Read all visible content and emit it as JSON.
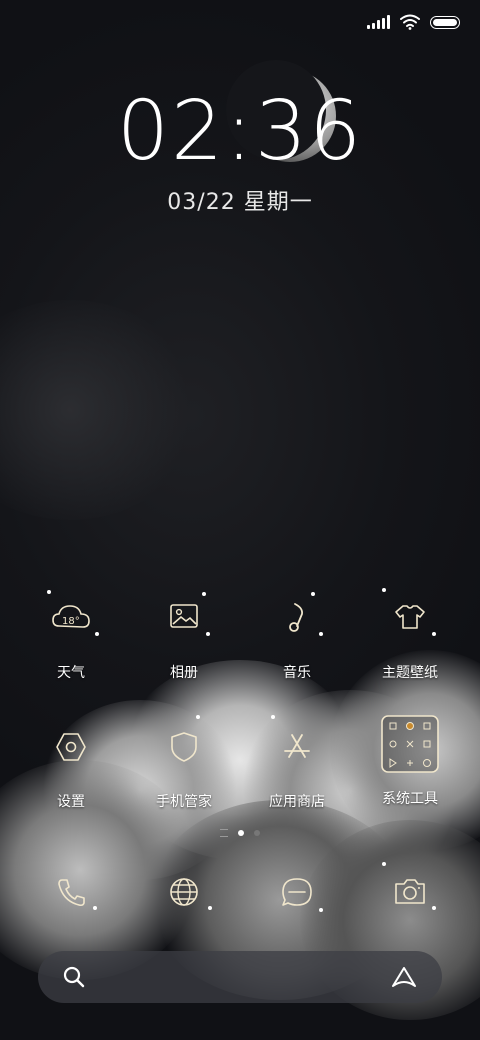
{
  "status_bar": {
    "icons": [
      "signal-icon",
      "wifi-icon",
      "battery-icon"
    ]
  },
  "lock": {
    "time": "02:36",
    "date": "03/22 星期一"
  },
  "apps": [
    {
      "label": "天气",
      "icon": "weather-icon",
      "temp": "18°"
    },
    {
      "label": "相册",
      "icon": "gallery-icon"
    },
    {
      "label": "音乐",
      "icon": "music-icon"
    },
    {
      "label": "主题壁纸",
      "icon": "theme-icon"
    },
    {
      "label": "设置",
      "icon": "settings-icon"
    },
    {
      "label": "手机管家",
      "icon": "security-icon"
    },
    {
      "label": "应用商店",
      "icon": "app-store-icon"
    },
    {
      "label": "系统工具",
      "icon": "folder-icon"
    }
  ],
  "dock": [
    {
      "icon": "phone-icon"
    },
    {
      "icon": "browser-icon"
    },
    {
      "icon": "messages-icon"
    },
    {
      "icon": "camera-icon"
    }
  ],
  "page_indicator": {
    "pages": 2,
    "current": 1
  },
  "search_bar": {
    "left_icon": "search-icon",
    "right_icon": "assistant-icon"
  },
  "colors": {
    "icon_stroke": "#f0e6cc",
    "background": "#111216"
  }
}
